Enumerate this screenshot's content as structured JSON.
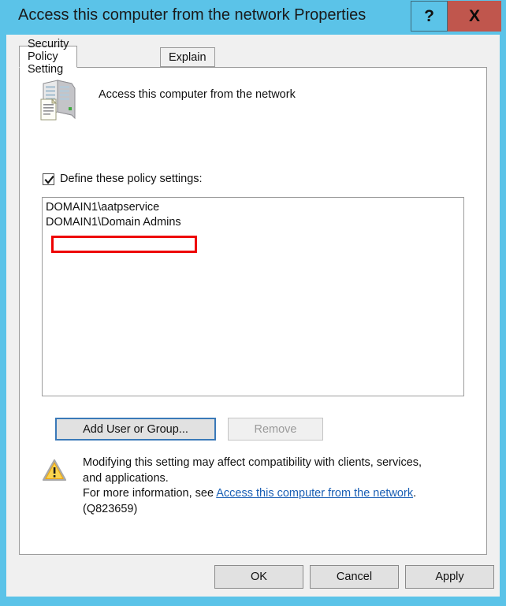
{
  "window": {
    "title": "Access this computer from the network Properties",
    "accent_color": "#5bc3e8",
    "close_color": "#c0564d",
    "help_label": "?",
    "close_label": "X",
    "help_icon": "question-mark-icon",
    "close_icon": "close-x-icon"
  },
  "tabs": [
    {
      "label": "Security Policy Setting",
      "active": true
    },
    {
      "label": "Explain",
      "active": false
    }
  ],
  "policy": {
    "icon": "server-policy-icon",
    "name": "Access this computer from the network",
    "define_label": "Define these policy settings:",
    "define_checked": true,
    "checkbox_icon": "checkmark-icon"
  },
  "principals": [
    "DOMAIN1\\aatpservice",
    "DOMAIN1\\Domain Admins"
  ],
  "annotation": {
    "color": "#ee0000",
    "targets_item": 0
  },
  "list_actions": {
    "add_label": "Add User or Group...",
    "remove_label": "Remove",
    "remove_disabled": true,
    "add_focused": true
  },
  "warning": {
    "icon": "warning-triangle-icon",
    "line1": "Modifying this setting may affect compatibility with clients, services,",
    "line2": "and applications.",
    "line3_prefix": "For more information, see ",
    "link_text": "Access this computer from the network",
    "line3_suffix": ".",
    "line4": "(Q823659)",
    "link_color": "#1a5fb4"
  },
  "footer": {
    "ok_label": "OK",
    "cancel_label": "Cancel",
    "apply_label": "Apply"
  }
}
